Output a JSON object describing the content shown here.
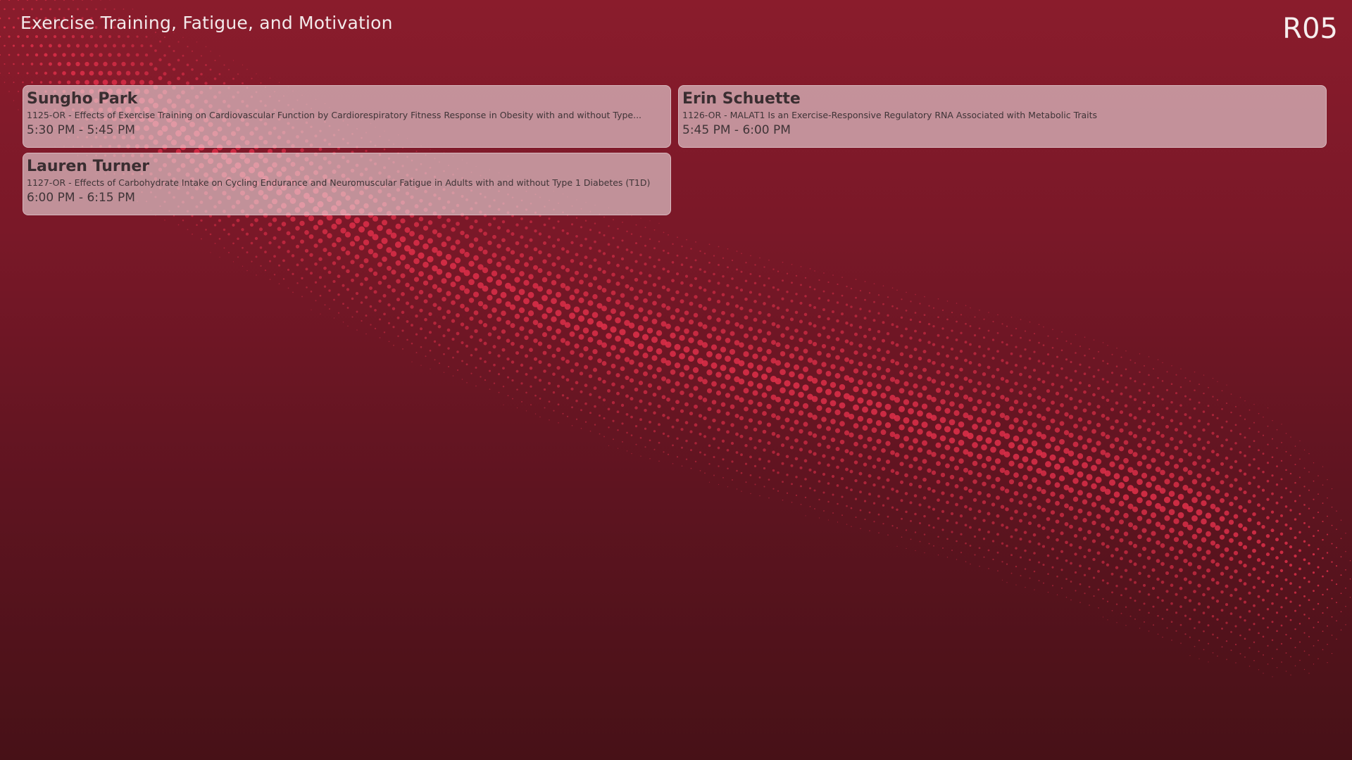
{
  "header": {
    "title": "Exercise Training, Fatigue, and Motivation",
    "room": "R05"
  },
  "sessions": [
    {
      "name": "Sungho Park",
      "abstract": "1125-OR - Effects of Exercise Training on Cardiovascular Function by Cardiorespiratory Fitness Response in Obesity with and without Type...",
      "time": "5:30 PM - 5:45 PM"
    },
    {
      "name": "Erin Schuette",
      "abstract": "1126-OR - MALAT1 Is an Exercise-Responsive Regulatory RNA Associated with Metabolic Traits",
      "time": "5:45 PM - 6:00 PM"
    },
    {
      "name": "Lauren Turner",
      "abstract": "1127-OR - Effects of Carbohydrate Intake on Cycling Endurance and Neuromuscular Fatigue in Adults with and without Type 1 Diabetes (T1D)",
      "time": "6:00 PM - 6:15 PM"
    }
  ],
  "colors": {
    "background_top": "#8a1c2c",
    "background_bottom": "#471117",
    "dot_accent": "#e0304a",
    "card_fill": "#ecdcde"
  }
}
